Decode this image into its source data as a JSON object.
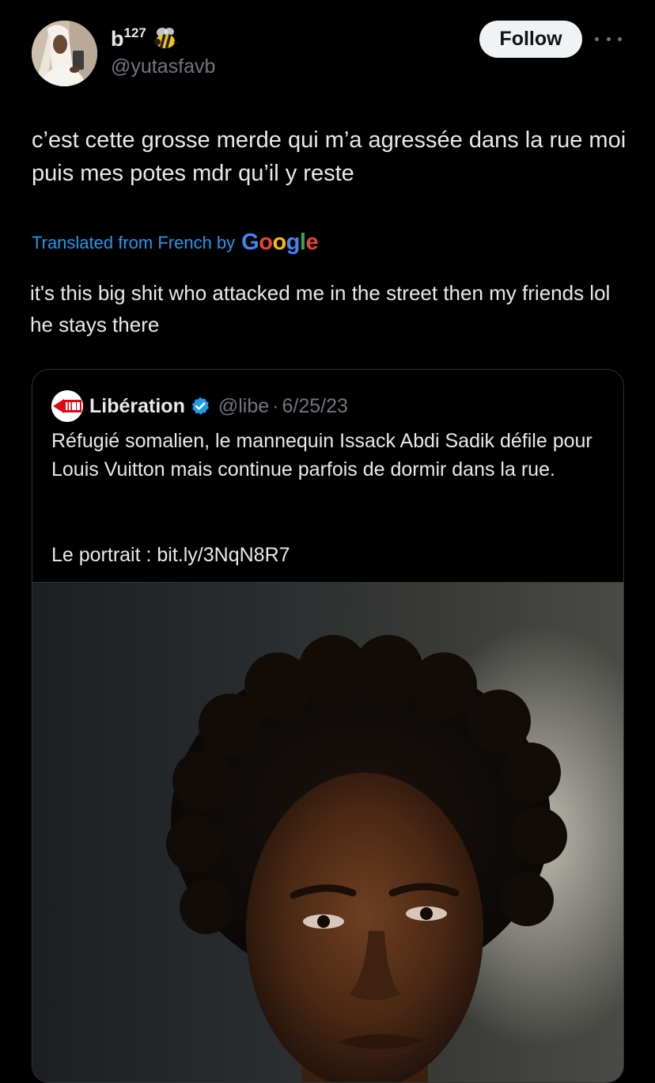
{
  "author": {
    "display_name": "b",
    "display_name_sup": "127",
    "emoji": "bee-icon",
    "handle": "@yutasfavb"
  },
  "actions": {
    "follow_label": "Follow",
    "more_icon": "more-horizontal-icon"
  },
  "tweet": {
    "text": "c’est cette grosse merde qui m’a agressée dans la rue moi puis mes potes mdr qu’il y reste",
    "translated_label": "Translated from French by",
    "translation_provider": "Google",
    "translation": "it's this big shit who attacked me in the street then my friends lol he stays there"
  },
  "quote": {
    "logo": "libe-logo-icon",
    "name": "Libération",
    "verified_icon": "verified-badge-icon",
    "handle": "@libe",
    "separator": "·",
    "date": "6/25/23",
    "text": "Réfugié somalien, le mannequin Issack Abdi Sadik défile pour Louis Vuitton mais continue parfois de dormir dans la rue.",
    "link_text": "Le portrait : bit.ly/3NqN8R7",
    "image": "portrait-photo"
  },
  "colors": {
    "background": "#000000",
    "text_primary": "#e7e9ea",
    "text_secondary": "#71767b",
    "link_blue": "#1d9bf0",
    "verified_blue": "#1d9bf0",
    "follow_bg": "#eff3f4",
    "border": "#2f3336"
  }
}
